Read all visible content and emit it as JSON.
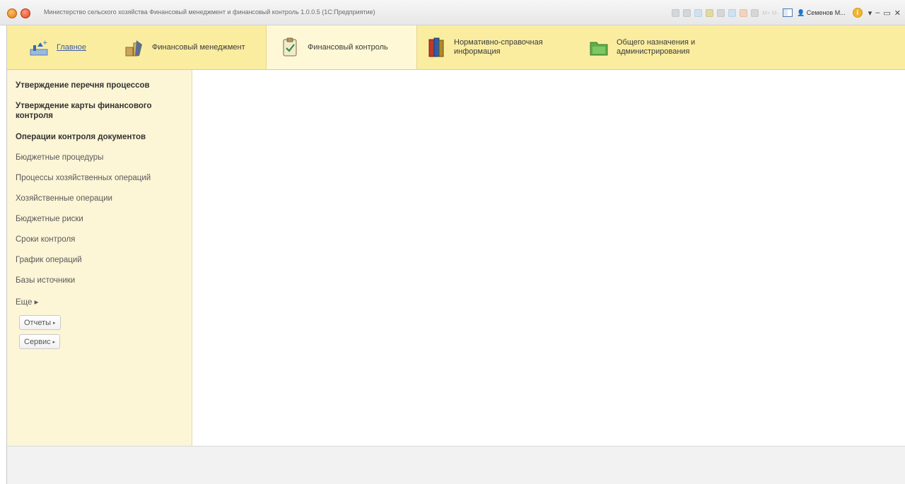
{
  "titlebar": {
    "title": "Министерство сельского хозяйства Финансовый менеджмент и финансовый контроль 1.0.0.5 (1С:Предприятие)",
    "user": "Семенов М...",
    "info_icon": "i",
    "minimize": "–",
    "restore": "▭",
    "close": "✕",
    "dim_text": "M+ M-"
  },
  "sections": [
    {
      "label": "Главное",
      "icon": "home-icon"
    },
    {
      "label": "Финансовый менеджмент",
      "icon": "finance-management-icon"
    },
    {
      "label": "Финансовый контроль",
      "icon": "clipboard-check-icon"
    },
    {
      "label": "Нормативно-справочная информация",
      "icon": "books-icon"
    },
    {
      "label": "Общего назначения и администрирования",
      "icon": "folder-icon"
    }
  ],
  "sidebar": {
    "bold_items": [
      "Утверждение перечня процессов",
      "Утверждение карты финансового контроля",
      "Операции контроля документов"
    ],
    "items": [
      "Бюджетные процедуры",
      "Процессы хозяйственных операций",
      "Хозяйственные операции",
      "Бюджетные риски",
      "Сроки контроля",
      "График операций",
      "Базы источники",
      "Еще ▸"
    ],
    "reports_label": "Отчеты",
    "service_label": "Сервис",
    "arrow": "▸"
  },
  "colors": {
    "sections_bg": "#fbeda0",
    "sidebar_bg": "#fcf5d6",
    "active_section_bg": "#fff8d6",
    "link": "#3a5ca8"
  }
}
